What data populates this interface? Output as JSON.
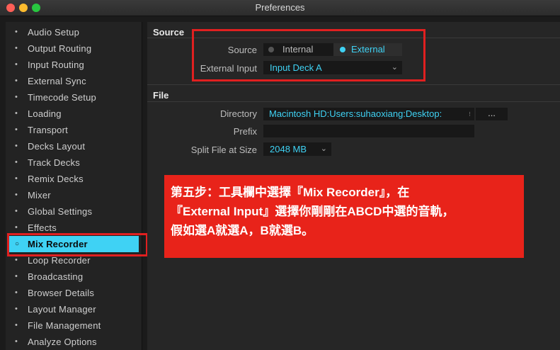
{
  "window": {
    "title": "Preferences"
  },
  "sidebar": {
    "items": [
      {
        "label": "Audio Setup"
      },
      {
        "label": "Output Routing"
      },
      {
        "label": "Input Routing"
      },
      {
        "label": "External Sync"
      },
      {
        "label": "Timecode Setup"
      },
      {
        "label": "Loading"
      },
      {
        "label": "Transport"
      },
      {
        "label": "Decks Layout"
      },
      {
        "label": "Track Decks"
      },
      {
        "label": "Remix Decks"
      },
      {
        "label": "Mixer"
      },
      {
        "label": "Global Settings"
      },
      {
        "label": "Effects"
      },
      {
        "label": "Mix Recorder"
      },
      {
        "label": "Loop Recorder"
      },
      {
        "label": "Broadcasting"
      },
      {
        "label": "Browser Details"
      },
      {
        "label": "Layout Manager"
      },
      {
        "label": "File Management"
      },
      {
        "label": "Analyze Options"
      }
    ],
    "selected_index": 13
  },
  "source": {
    "header": "Source",
    "source_label": "Source",
    "internal_label": "Internal",
    "external_label": "External",
    "selected": "External",
    "external_input_label": "External Input",
    "external_input_value": "Input Deck A"
  },
  "file": {
    "header": "File",
    "directory_label": "Directory",
    "directory_value": "Macintosh HD:Users:suhaoxiang:Desktop:",
    "browse_label": "...",
    "prefix_label": "Prefix",
    "prefix_value": "",
    "split_label": "Split File at Size",
    "split_value": "2048 MB"
  },
  "annotation": {
    "line1": "第五步：工具欄中選擇『Mix Recorder』，在",
    "line2": "『External Input』選擇你剛剛在ABCD中選的音軌，",
    "line3": "假如選A就選A，B就選B。"
  },
  "colors": {
    "accent": "#3fd2f4",
    "annotation_red": "#e8231a"
  }
}
